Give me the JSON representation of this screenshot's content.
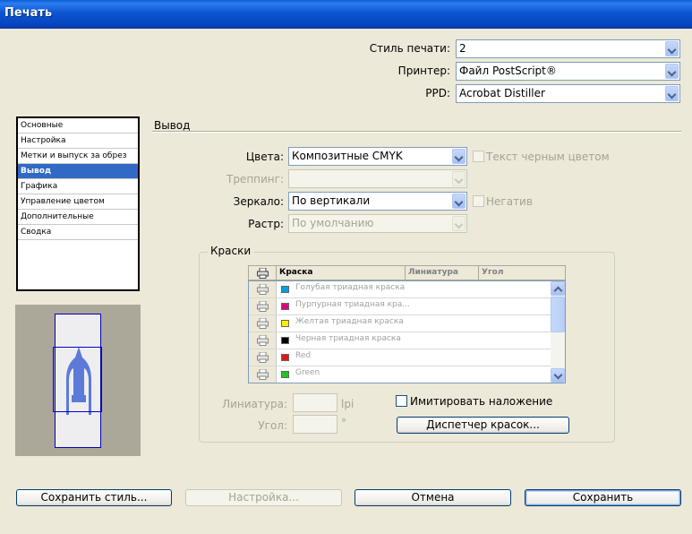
{
  "window": {
    "title": "Печать"
  },
  "top": {
    "preset_label": "Стиль печати:",
    "preset_value": "2",
    "printer_label": "Принтер:",
    "printer_value": "Файл PostScript®",
    "ppd_label": "PPD:",
    "ppd_value": "Acrobat Distiller"
  },
  "sidebar": {
    "items": [
      {
        "label": "Основные"
      },
      {
        "label": "Настройка"
      },
      {
        "label": "Метки и выпуск за обрез"
      },
      {
        "label": "Вывод"
      },
      {
        "label": "Графика"
      },
      {
        "label": "Управление цветом"
      },
      {
        "label": "Дополнительные"
      },
      {
        "label": "Сводка"
      }
    ],
    "selected": "Вывод"
  },
  "output": {
    "section_title": "Вывод",
    "color_label": "Цвета:",
    "color_value": "Композитные CMYK",
    "text_black_label": "Текст черным цветом",
    "trapping_label": "Треппинг:",
    "trapping_value": "",
    "mirror_label": "Зеркало:",
    "mirror_value": "По вертикали",
    "negative_label": "Негатив",
    "screening_label": "Растр:",
    "screening_value": "По умолчанию"
  },
  "inks": {
    "group_title": "Краски",
    "columns": {
      "ink": "Краска",
      "frequency": "Линиатура",
      "angle": "Угол"
    },
    "rows": [
      {
        "name": "Голубая триадная краска",
        "color": "#00a0e0"
      },
      {
        "name": "Пурпурная триадная кра...",
        "color": "#e0007a"
      },
      {
        "name": "Желтая триадная краска",
        "color": "#ffee00"
      },
      {
        "name": "Черная триадная краска",
        "color": "#000000"
      },
      {
        "name": "Red",
        "color": "#e01818"
      },
      {
        "name": "Green",
        "color": "#1ec81e"
      }
    ],
    "frequency_label": "Линиатура:",
    "frequency_unit": "lpi",
    "angle_label": "Угол:",
    "angle_unit": "°",
    "simulate_overprint_label": "Имитировать наложение",
    "ink_manager_label": "Диспетчер красок..."
  },
  "buttons": {
    "save_preset": "Сохранить стиль...",
    "setup": "Настройка...",
    "cancel": "Отмена",
    "save": "Сохранить"
  },
  "colors": {
    "title_bar": "#0a55d0",
    "selection": "#316ac5",
    "dialog_bg": "#ece9d8"
  }
}
